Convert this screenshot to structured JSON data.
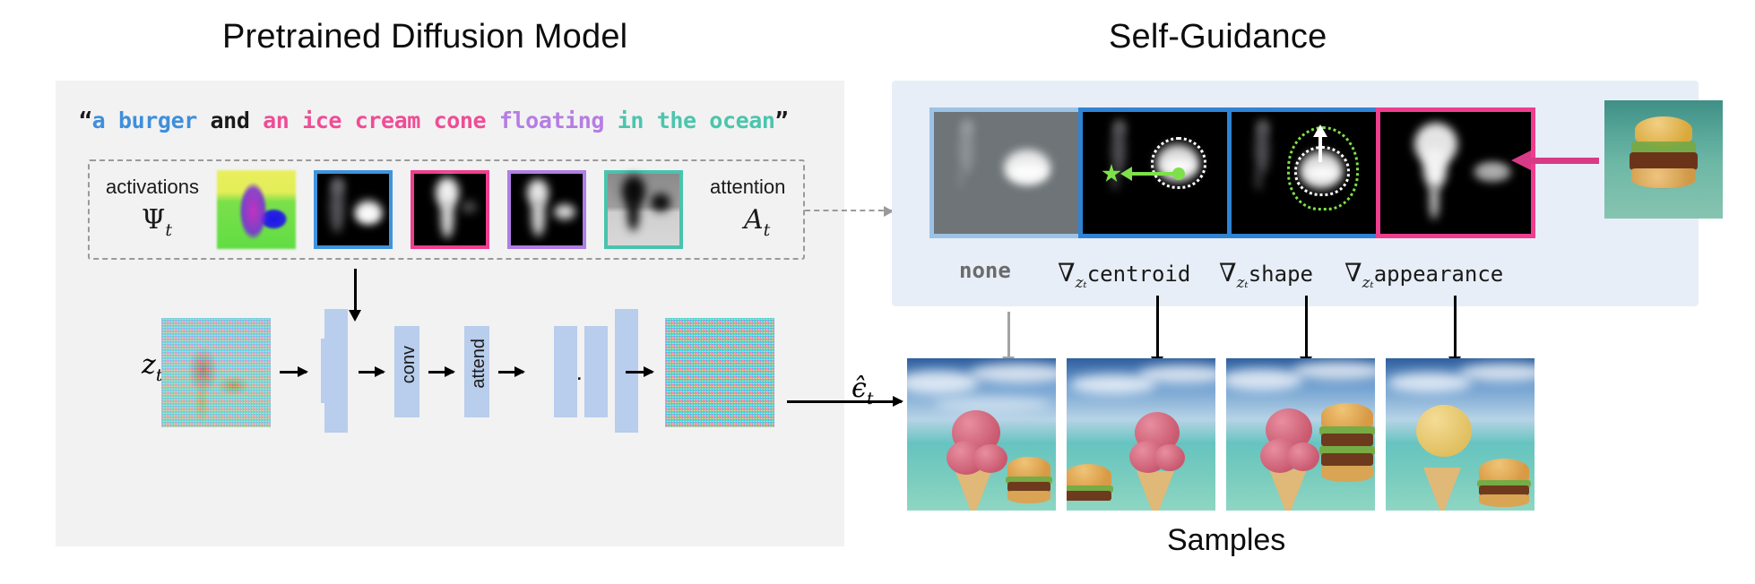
{
  "figure": {
    "left_title": "Pretrained Diffusion Model",
    "right_title": "Self-Guidance",
    "samples_label": "Samples"
  },
  "prompt": {
    "open_quote": "“",
    "close_quote": "”",
    "segments": [
      {
        "text": "a burger",
        "color": "#3f8fdb"
      },
      {
        "text": " and ",
        "color": "#1a1a1a"
      },
      {
        "text": "an ice cream cone",
        "color": "#ef4d96"
      },
      {
        "text": " ",
        "color": "#1a1a1a"
      },
      {
        "text": "floating",
        "color": "#b57de4"
      },
      {
        "text": " ",
        "color": "#1a1a1a"
      },
      {
        "text": "in the ocean",
        "color": "#4cc5ad"
      }
    ],
    "full_text": "“a burger and an ice cream cone floating in the ocean”"
  },
  "activations_box": {
    "activations_label": "activations",
    "activations_symbol": "Ψ",
    "activations_subscript": "t",
    "attention_label": "attention",
    "attention_symbol": "A",
    "attention_subscript": "t",
    "maps": [
      {
        "name": "activations-rgb-map",
        "border": "none",
        "border_color": "#00000000"
      },
      {
        "name": "attention-map-burger",
        "border_color": "#3f93dd"
      },
      {
        "name": "attention-map-ice-cream-cone",
        "border_color": "#ef3e8e"
      },
      {
        "name": "attention-map-floating",
        "border_color": "#b07de4"
      },
      {
        "name": "attention-map-ocean",
        "border_color": "#49c3ae"
      }
    ]
  },
  "unet": {
    "input_label": "z",
    "input_subscript": "t",
    "conv_label": "conv",
    "attend_label": "attend",
    "ellipsis": "…",
    "output_label": "ϵ̂",
    "output_subscript": "t"
  },
  "self_guidance": {
    "panels": [
      {
        "caption_symbol": "",
        "caption_sub": "",
        "caption_word": "none",
        "border_color": "#9cc2e5",
        "arrow_color": "#a3a3a3",
        "tile_bg": "#6e7478"
      },
      {
        "caption_symbol": "∇",
        "caption_sub": "zₜ",
        "caption_word": "centroid",
        "border_color": "#2f83d4",
        "arrow_color": "#000000",
        "tile_bg": "#000000",
        "overlay_color": "#7ee04a"
      },
      {
        "caption_symbol": "∇",
        "caption_sub": "zₜ",
        "caption_word": "shape",
        "border_color": "#2f83d4",
        "arrow_color": "#000000",
        "tile_bg": "#000000",
        "overlay_color": "#7ee04a"
      },
      {
        "caption_symbol": "∇",
        "caption_sub": "zₜ",
        "caption_word": "appearance",
        "border_color": "#ef3e8e",
        "arrow_color": "#000000",
        "tile_bg": "#000000",
        "overlay_color": "#d83a86"
      }
    ],
    "reference_image_name": "burger-in-ocean-reference"
  },
  "samples": [
    {
      "name": "sample-none"
    },
    {
      "name": "sample-centroid"
    },
    {
      "name": "sample-shape"
    },
    {
      "name": "sample-appearance"
    }
  ],
  "colors": {
    "left_panel_bg": "#f2f2f2",
    "right_panel_bg": "#e7eef8",
    "unet_block": "#b9cdec",
    "dashed_border": "#9a9a9a",
    "blue": "#3f8fdb",
    "pink": "#ef4d96",
    "purple": "#b57de4",
    "teal": "#4cc5ad",
    "green_overlay": "#7ee04a",
    "magenta_arrow": "#d83a86",
    "grey_arrow": "#a3a3a3"
  }
}
